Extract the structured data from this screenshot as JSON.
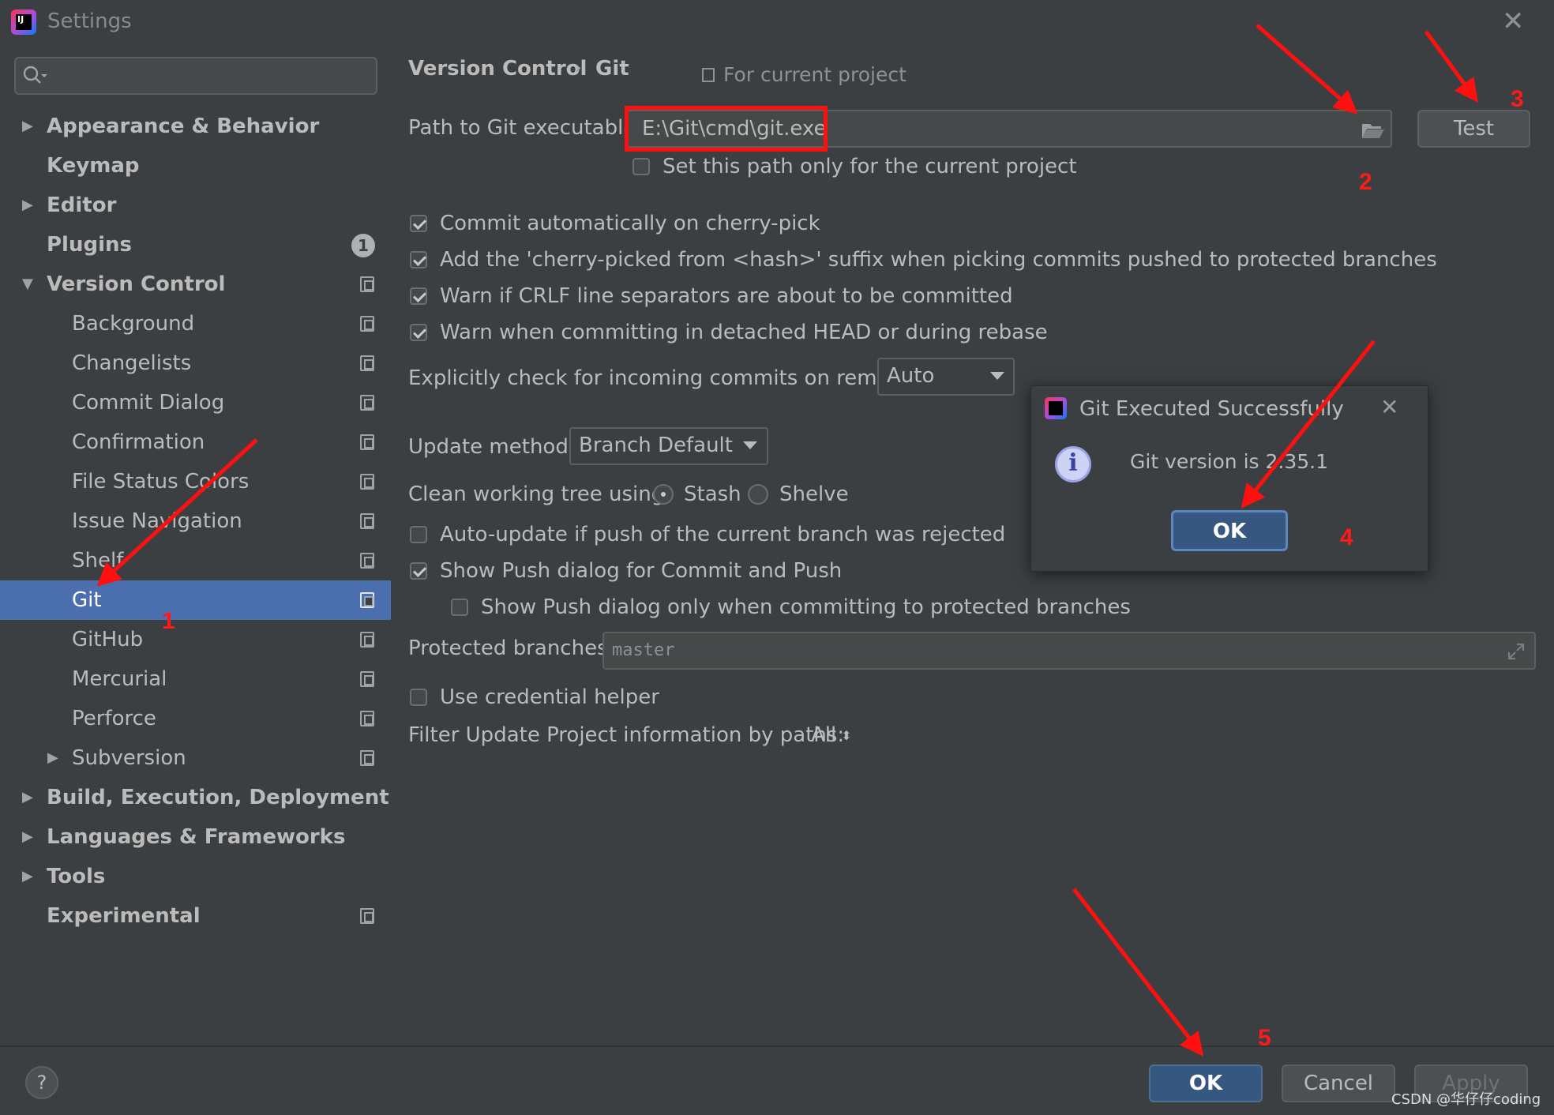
{
  "window": {
    "title": "Settings"
  },
  "search": {
    "placeholder": ""
  },
  "sidebar": {
    "items": [
      {
        "label": "Appearance & Behavior"
      },
      {
        "label": "Keymap"
      },
      {
        "label": "Editor"
      },
      {
        "label": "Plugins",
        "badge": "1"
      },
      {
        "label": "Version Control"
      },
      {
        "label": "Background"
      },
      {
        "label": "Changelists"
      },
      {
        "label": "Commit Dialog"
      },
      {
        "label": "Confirmation"
      },
      {
        "label": "File Status Colors"
      },
      {
        "label": "Issue Navigation"
      },
      {
        "label": "Shelf"
      },
      {
        "label": "Git",
        "selected": true
      },
      {
        "label": "GitHub"
      },
      {
        "label": "Mercurial"
      },
      {
        "label": "Perforce"
      },
      {
        "label": "Subversion"
      },
      {
        "label": "Build, Execution, Deployment"
      },
      {
        "label": "Languages & Frameworks"
      },
      {
        "label": "Tools"
      },
      {
        "label": "Experimental"
      }
    ]
  },
  "breadcrumb": {
    "parent": "Version Control",
    "separator": "›",
    "current": "Git",
    "scope": "For current project"
  },
  "git": {
    "path_label": "Path to Git executable:",
    "path_value": "E:\\Git\\cmd\\git.exe",
    "test_button": "Test",
    "current_project_only": {
      "label": "Set this path only for the current project",
      "checked": false
    },
    "options": [
      {
        "label": "Commit automatically on cherry-pick",
        "checked": true
      },
      {
        "label": "Add the 'cherry-picked from <hash>' suffix when picking commits pushed to protected branches",
        "checked": true
      },
      {
        "label": "Warn if CRLF line separators are about to be committed",
        "checked": true
      },
      {
        "label": "Warn when committing in detached HEAD or during rebase",
        "checked": true
      }
    ],
    "incoming_label": "Explicitly check for incoming commits on remotes:",
    "incoming_value": "Auto",
    "update_method_label": "Update method:",
    "update_method_value": "Branch Default",
    "clean_tree_label": "Clean working tree using:",
    "clean_tree_options": [
      "Stash",
      "Shelve"
    ],
    "clean_tree_selected": "Stash",
    "auto_update": {
      "label": "Auto-update if push of the current branch was rejected",
      "checked": false
    },
    "show_push": {
      "label": "Show Push dialog for Commit and Push",
      "checked": true
    },
    "show_push_protected": {
      "label": "Show Push dialog only when committing to protected branches",
      "checked": false
    },
    "protected_label": "Protected branches:",
    "protected_value": "master",
    "credential": {
      "label": "Use credential helper",
      "checked": false
    },
    "filter_label": "Filter Update Project information by paths:",
    "filter_value": "All"
  },
  "dialog": {
    "title": "Git Executed Successfully",
    "message": "Git version is 2.35.1",
    "ok": "OK"
  },
  "footer": {
    "help": "?",
    "ok": "OK",
    "cancel": "Cancel",
    "apply": "Apply"
  },
  "annotations": [
    "1",
    "2",
    "3",
    "4",
    "5"
  ],
  "watermark": "CSDN @华仔仔coding",
  "colors": {
    "selection": "#4b6eaf",
    "annotation": "#ff1a1a",
    "primary_button": "#365880"
  }
}
